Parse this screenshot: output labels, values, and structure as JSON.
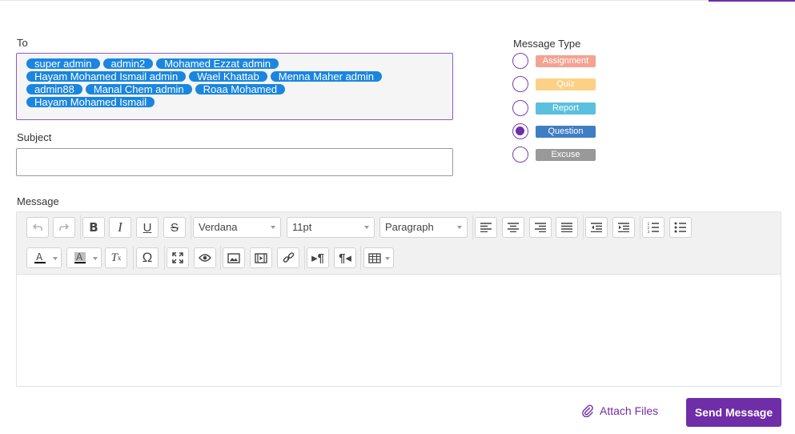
{
  "form": {
    "to_label": "To",
    "subject_label": "Subject",
    "subject_value": "",
    "message_label": "Message",
    "type_label": "Message Type"
  },
  "recipients": [
    "super admin",
    "admin2",
    "Mohamed Ezzat admin",
    "Hayam Mohamed Ismail admin",
    "Wael Khattab",
    "Menna Maher admin",
    "admin88",
    "Manal Chem admin",
    "Roaa Mohamed",
    "Hayam Mohamed Ismail"
  ],
  "message_types": [
    {
      "label": "Assignment",
      "color": "#f4a393",
      "checked": false
    },
    {
      "label": "Quiz",
      "color": "#fdd185",
      "checked": false
    },
    {
      "label": "Report",
      "color": "#5bc0de",
      "checked": false
    },
    {
      "label": "Question",
      "color": "#3f7ec5",
      "checked": true
    },
    {
      "label": "Excuse",
      "color": "#999999",
      "checked": false
    }
  ],
  "editor": {
    "font_family": "Verdana",
    "font_size": "11pt",
    "block_format": "Paragraph",
    "row1_icons": [
      "undo-icon",
      "redo-icon",
      "bold-icon",
      "italic-icon",
      "underline-icon",
      "strikethrough-icon",
      "align-left-icon",
      "align-center-icon",
      "align-right-icon",
      "justify-icon",
      "outdent-icon",
      "indent-icon",
      "numbered-list-icon",
      "bullet-list-icon"
    ],
    "row2_icons": [
      "text-color-icon",
      "background-color-icon",
      "clear-formatting-icon",
      "special-character-icon",
      "fullscreen-icon",
      "preview-icon",
      "image-icon",
      "media-icon",
      "link-icon",
      "ltr-icon",
      "rtl-icon",
      "table-icon"
    ],
    "content": ""
  },
  "actions": {
    "attach_label": "Attach Files",
    "send_label": "Send Message"
  },
  "colors": {
    "accent": "#6f2da8",
    "chip": "#1a86df"
  }
}
